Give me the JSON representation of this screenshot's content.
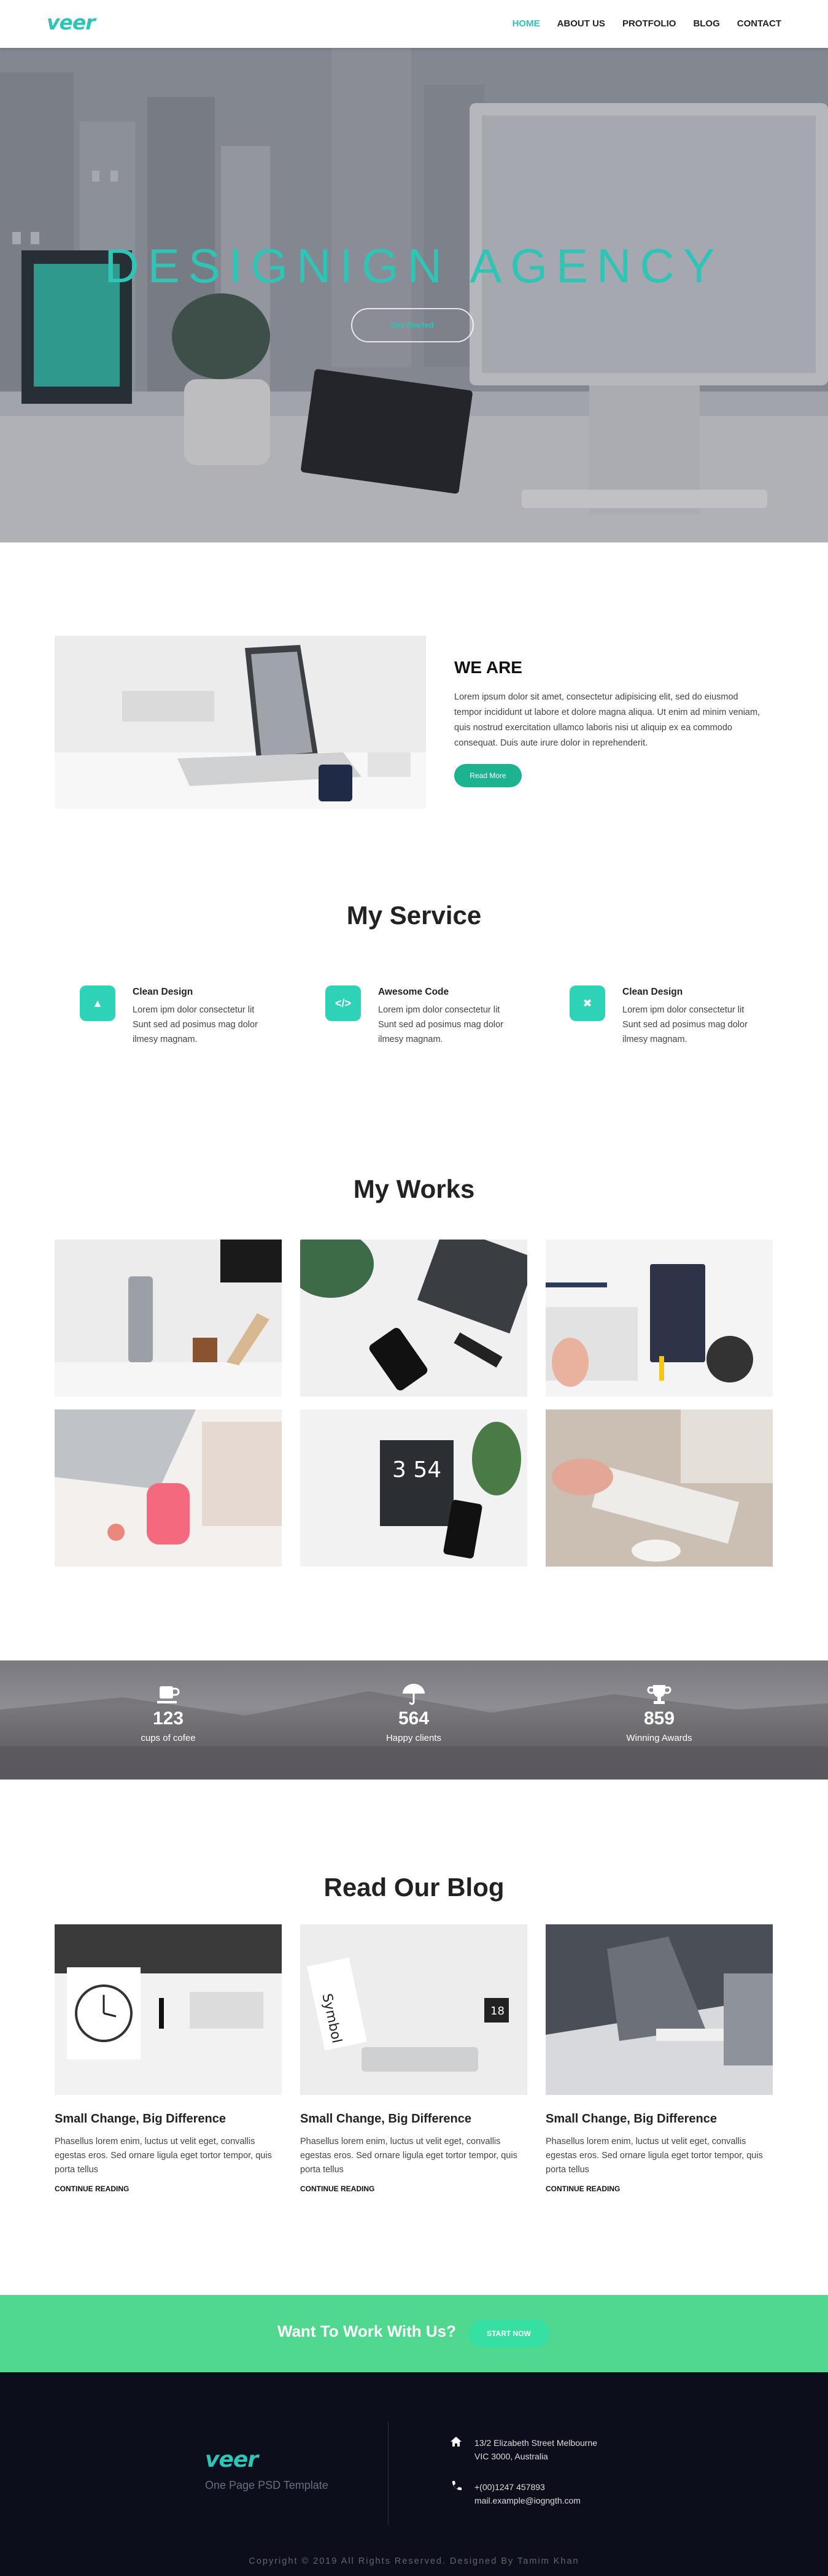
{
  "brand": {
    "logo": "veer",
    "accent": "#2ec4b6"
  },
  "nav": {
    "items": [
      "HOME",
      "ABOUT US",
      "PROTFOLIO",
      "BLOG",
      "CONTACT"
    ],
    "active": "HOME"
  },
  "hero": {
    "title": "DESIGNIGN AGENCY",
    "button": "Get Started"
  },
  "about": {
    "heading": "WE ARE",
    "text": "Lorem ipsum dolor sit amet, consectetur adipisicing elit, sed do eiusmod tempor incididunt ut labore et dolore magna aliqua. Ut enim ad minim veniam, quis nostrud exercitation ullamco laboris nisi ut aliquip ex ea commodo consequat. Duis aute irure dolor in reprehenderit.",
    "button": "Read More"
  },
  "services": {
    "title": "My Service",
    "items": [
      {
        "title": "Clean Design",
        "desc": "Lorem ipm dolor consectetur lit Sunt sed ad posimus mag dolor ilmesy magnam.",
        "icon": "design-icon"
      },
      {
        "title": "Awesome Code",
        "desc": "Lorem ipm dolor consectetur lit Sunt sed ad posimus mag dolor ilmesy magnam.",
        "icon": "code-icon"
      },
      {
        "title": "Clean Design",
        "desc": "Lorem ipm dolor consectetur lit Sunt sed ad posimus mag dolor ilmesy magnam.",
        "icon": "tools-icon"
      }
    ]
  },
  "works": {
    "title": "My Works"
  },
  "stats": [
    {
      "value": "123",
      "label": "cups of cofee",
      "icon": "coffee-cup-icon"
    },
    {
      "value": "564",
      "label": "Happy clients",
      "icon": "umbrella-icon"
    },
    {
      "value": "859",
      "label": "Winning Awards",
      "icon": "trophy-icon"
    }
  ],
  "blog": {
    "title": "Read Our Blog",
    "posts": [
      {
        "title": "Small Change, Big Difference",
        "desc": "Phasellus lorem enim, luctus ut velit eget, convallis egestas eros. Sed ornare ligula eget tortor tempor, quis porta tellus",
        "link": "CONTINUE READING"
      },
      {
        "title": "Small Change, Big Difference",
        "desc": "Phasellus lorem enim, luctus ut velit eget, convallis egestas eros. Sed ornare ligula eget tortor tempor, quis porta tellus",
        "link": "CONTINUE READING"
      },
      {
        "title": "Small Change, Big Difference",
        "desc": "Phasellus lorem enim, luctus ut velit eget, convallis egestas eros. Sed ornare ligula eget tortor tempor, quis porta tellus",
        "link": "CONTINUE READING"
      }
    ]
  },
  "cta": {
    "text": "Want To Work With Us?",
    "button": "START NOW"
  },
  "footer": {
    "logo": "veer",
    "tagline": "One Page PSD Template",
    "address_line1": "13/2 Elizabeth Street Melbourne",
    "address_line2": "VIC 3000, Australia",
    "phone": "+(00)1247 457893",
    "email": "mail.example@iogngth.com",
    "copyright": "Copyright © 2019 All Rights Reserved. Designed By Tamim Khan"
  }
}
